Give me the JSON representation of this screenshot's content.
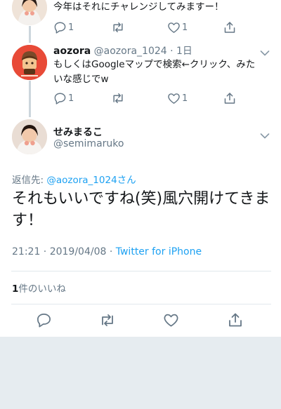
{
  "tweets": [
    {
      "text": "今年はそれにチャレンジしてみますー！",
      "reply_count": "1",
      "like_count": "1"
    },
    {
      "name": "aozora",
      "handle": "@aozora_1024",
      "time": "· 1日",
      "text": "もしくはGoogleマップで検索←クリック、みたいな感じでw",
      "reply_count": "1",
      "like_count": "1"
    }
  ],
  "main_tweet": {
    "name": "せみまるこ",
    "handle": "@semimaruko",
    "reply_to_prefix": "返信先:",
    "reply_to_handle": "@aozora_1024さん",
    "text": "それもいいですね(笑)風穴開けてきます！",
    "timestamp": "21:21 · 2019/04/08",
    "source_sep": "·",
    "source": "Twitter for iPhone",
    "likes_count": "1",
    "likes_label": "件のいいね"
  },
  "colors": {
    "accent": "#1da1f2",
    "secondary_text": "#657786",
    "divider": "#e1e8ed"
  },
  "icons": [
    "reply-icon",
    "retweet-icon",
    "like-icon",
    "share-icon",
    "chevron-down-icon"
  ]
}
